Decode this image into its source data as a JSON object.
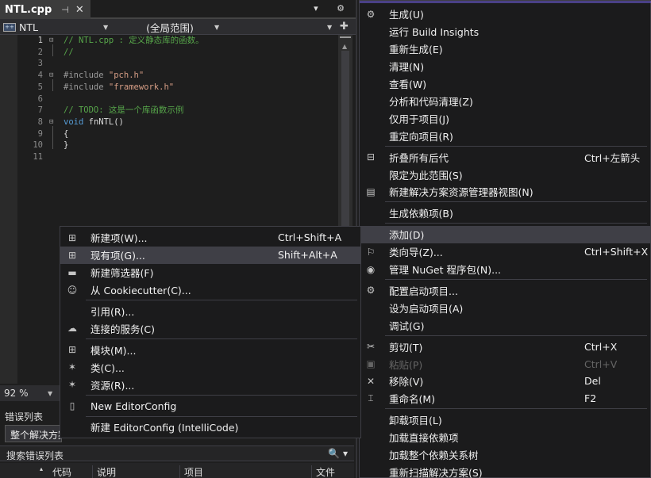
{
  "editor": {
    "tab_label": "NTL.cpp",
    "tab_pin": "⊣",
    "tab_close": "✕",
    "tab_overflow": "▾ ⚙",
    "project": "NTL",
    "scope": "(全局范围)",
    "member": "",
    "zoom": "92 %",
    "lines": [
      {
        "n": "1",
        "fold": "⊟",
        "parts": [
          {
            "c": "c-cm",
            "t": "// NTL.cpp : 定义静态库的函数。"
          }
        ]
      },
      {
        "n": "2",
        "fold": "",
        "parts": [
          {
            "c": "c-cm",
            "t": "//"
          }
        ]
      },
      {
        "n": "3",
        "fold": "",
        "parts": []
      },
      {
        "n": "4",
        "fold": "⊟",
        "parts": [
          {
            "c": "c-pp",
            "t": "#include "
          },
          {
            "c": "c-str",
            "t": "\"pch.h\""
          }
        ]
      },
      {
        "n": "5",
        "fold": "",
        "parts": [
          {
            "c": "c-pp",
            "t": "#include "
          },
          {
            "c": "c-str",
            "t": "\"framework.h\""
          }
        ]
      },
      {
        "n": "6",
        "fold": "",
        "parts": []
      },
      {
        "n": "7",
        "fold": "",
        "parts": [
          {
            "c": "c-cm",
            "t": "// TODO: 这是一个库函数示例"
          }
        ]
      },
      {
        "n": "8",
        "fold": "⊟",
        "parts": [
          {
            "c": "c-kw",
            "t": "void"
          },
          {
            "c": "c-pl",
            "t": " fnNTL()"
          }
        ]
      },
      {
        "n": "9",
        "fold": "",
        "parts": [
          {
            "c": "c-pl",
            "t": "{"
          }
        ]
      },
      {
        "n": "10",
        "fold": "",
        "parts": [
          {
            "c": "c-pl",
            "t": "}"
          }
        ]
      },
      {
        "n": "11",
        "fold": "",
        "parts": []
      }
    ]
  },
  "error_list": {
    "title": "错误列表",
    "scope": "整个解决方案",
    "search_placeholder": "搜索错误列表",
    "search_icon": "🔍",
    "columns": [
      "代码",
      "说明",
      "项目",
      "文件"
    ]
  },
  "main_menu": {
    "items": [
      {
        "label": "生成(U)",
        "shortcut": "",
        "icon": "build-icon",
        "glyph": "⚙",
        "sep_before": false,
        "disabled": false
      },
      {
        "label": "运行 Build Insights",
        "shortcut": "",
        "icon": "",
        "glyph": "",
        "sep_before": false,
        "disabled": false
      },
      {
        "label": "重新生成(E)",
        "shortcut": "",
        "icon": "",
        "glyph": "",
        "sep_before": false,
        "disabled": false
      },
      {
        "label": "清理(N)",
        "shortcut": "",
        "icon": "",
        "glyph": "",
        "sep_before": false,
        "disabled": false
      },
      {
        "label": "查看(W)",
        "shortcut": "",
        "icon": "",
        "glyph": "",
        "sep_before": false,
        "disabled": false
      },
      {
        "label": "分析和代码清理(Z)",
        "shortcut": "",
        "icon": "",
        "glyph": "",
        "sep_before": false,
        "disabled": false
      },
      {
        "label": "仅用于项目(J)",
        "shortcut": "",
        "icon": "",
        "glyph": "",
        "sep_before": false,
        "disabled": false
      },
      {
        "label": "重定向项目(R)",
        "shortcut": "",
        "icon": "",
        "glyph": "",
        "sep_before": false,
        "disabled": false
      },
      {
        "label": "折叠所有后代",
        "shortcut": "Ctrl+左箭头",
        "icon": "collapse-icon",
        "glyph": "⊟",
        "sep_before": true,
        "disabled": false
      },
      {
        "label": "限定为此范围(S)",
        "shortcut": "",
        "icon": "",
        "glyph": "",
        "sep_before": false,
        "disabled": false
      },
      {
        "label": "新建解决方案资源管理器视图(N)",
        "shortcut": "",
        "icon": "new-view-icon",
        "glyph": "▤",
        "sep_before": false,
        "disabled": false
      },
      {
        "label": "生成依赖项(B)",
        "shortcut": "",
        "icon": "",
        "glyph": "",
        "sep_before": true,
        "disabled": false
      },
      {
        "label": "添加(D)",
        "shortcut": "",
        "icon": "",
        "glyph": "",
        "sep_before": true,
        "disabled": false,
        "highlight": true
      },
      {
        "label": "类向导(Z)...",
        "shortcut": "Ctrl+Shift+X",
        "icon": "class-wizard-icon",
        "glyph": "⚐",
        "sep_before": false,
        "disabled": false
      },
      {
        "label": "管理 NuGet 程序包(N)...",
        "shortcut": "",
        "icon": "nuget-icon",
        "glyph": "◉",
        "sep_before": false,
        "disabled": false
      },
      {
        "label": "配置启动项目...",
        "shortcut": "",
        "icon": "gear-icon",
        "glyph": "⚙",
        "sep_before": true,
        "disabled": false
      },
      {
        "label": "设为启动项目(A)",
        "shortcut": "",
        "icon": "",
        "glyph": "",
        "sep_before": false,
        "disabled": false
      },
      {
        "label": "调试(G)",
        "shortcut": "",
        "icon": "",
        "glyph": "",
        "sep_before": false,
        "disabled": false
      },
      {
        "label": "剪切(T)",
        "shortcut": "Ctrl+X",
        "icon": "cut-icon",
        "glyph": "✂",
        "sep_before": true,
        "disabled": false
      },
      {
        "label": "粘贴(P)",
        "shortcut": "Ctrl+V",
        "icon": "paste-icon",
        "glyph": "▣",
        "sep_before": false,
        "disabled": true
      },
      {
        "label": "移除(V)",
        "shortcut": "Del",
        "icon": "remove-icon",
        "glyph": "✕",
        "sep_before": false,
        "disabled": false
      },
      {
        "label": "重命名(M)",
        "shortcut": "F2",
        "icon": "rename-icon",
        "glyph": "⌶",
        "sep_before": false,
        "disabled": false
      },
      {
        "label": "卸载项目(L)",
        "shortcut": "",
        "icon": "",
        "glyph": "",
        "sep_before": true,
        "disabled": false
      },
      {
        "label": "加载直接依赖项",
        "shortcut": "",
        "icon": "",
        "glyph": "",
        "sep_before": false,
        "disabled": false
      },
      {
        "label": "加载整个依赖关系树",
        "shortcut": "",
        "icon": "",
        "glyph": "",
        "sep_before": false,
        "disabled": false
      },
      {
        "label": "重新扫描解决方案(S)",
        "shortcut": "",
        "icon": "",
        "glyph": "",
        "sep_before": false,
        "disabled": false
      }
    ]
  },
  "add_menu": {
    "items": [
      {
        "label": "新建项(W)...",
        "shortcut": "Ctrl+Shift+A",
        "icon": "new-item-icon",
        "glyph": "⊞",
        "sep_before": false
      },
      {
        "label": "现有项(G)...",
        "shortcut": "Shift+Alt+A",
        "icon": "existing-item-icon",
        "glyph": "⊞",
        "sep_before": false,
        "highlight": true
      },
      {
        "label": "新建筛选器(F)",
        "shortcut": "",
        "icon": "folder-icon",
        "glyph": "▬",
        "sep_before": false
      },
      {
        "label": "从 Cookiecutter(C)...",
        "shortcut": "",
        "icon": "cookiecutter-icon",
        "glyph": "☺",
        "sep_before": false
      },
      {
        "label": "引用(R)...",
        "shortcut": "",
        "icon": "",
        "glyph": "",
        "sep_before": true
      },
      {
        "label": "连接的服务(C)",
        "shortcut": "",
        "icon": "connected-service-icon",
        "glyph": "☁",
        "sep_before": false
      },
      {
        "label": "模块(M)...",
        "shortcut": "",
        "icon": "module-icon",
        "glyph": "⊞",
        "sep_before": true
      },
      {
        "label": "类(C)...",
        "shortcut": "",
        "icon": "class-icon",
        "glyph": "✶",
        "sep_before": false
      },
      {
        "label": "资源(R)...",
        "shortcut": "",
        "icon": "resource-icon",
        "glyph": "✶",
        "sep_before": false
      },
      {
        "label": "New EditorConfig",
        "shortcut": "",
        "icon": "file-icon",
        "glyph": "▯",
        "sep_before": true
      },
      {
        "label": "新建 EditorConfig (IntelliCode)",
        "shortcut": "",
        "icon": "",
        "glyph": "",
        "sep_before": true
      }
    ]
  }
}
